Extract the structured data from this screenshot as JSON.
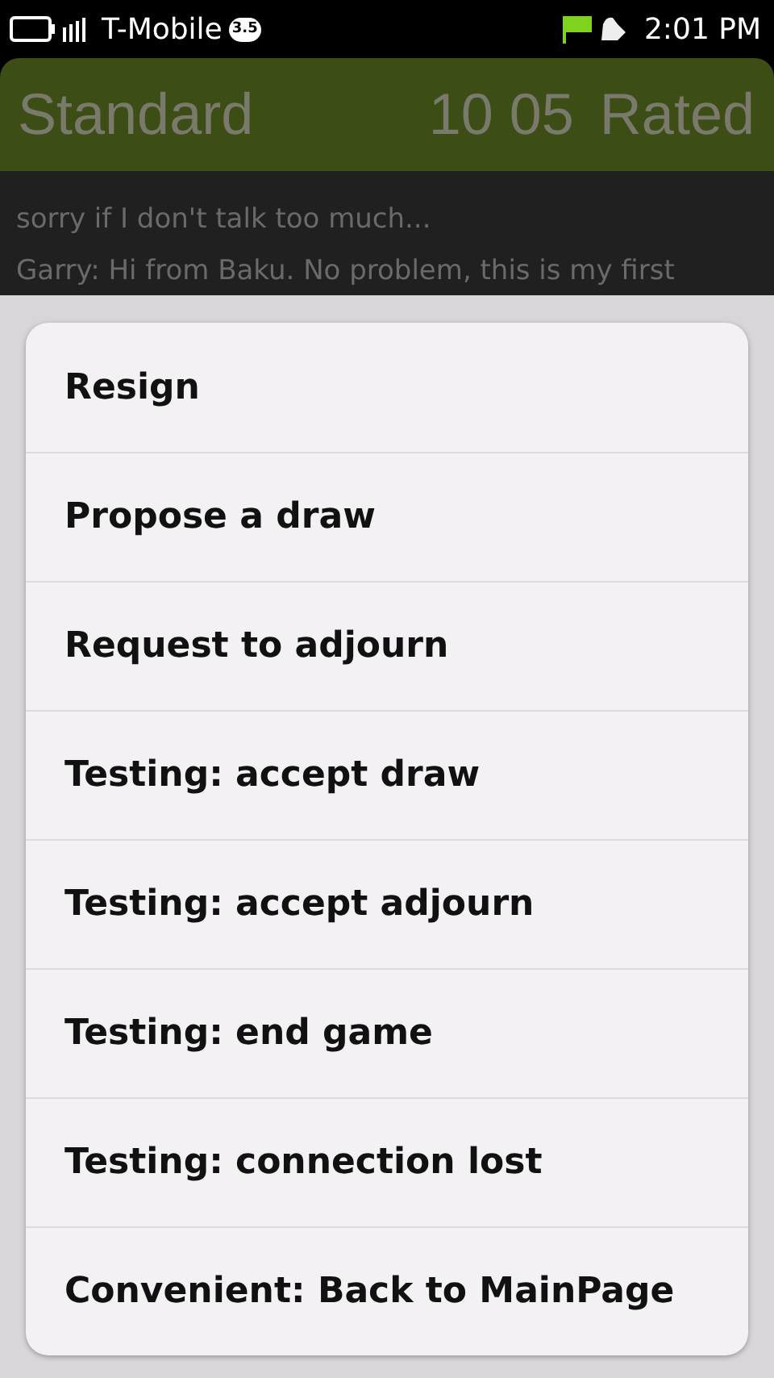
{
  "status_bar": {
    "carrier": "T-Mobile",
    "network_badge": "3.5",
    "time": "2:01 PM"
  },
  "header": {
    "title": "Standard",
    "time_control": "10 05",
    "rating": "Rated"
  },
  "chat": {
    "messages": [
      "sorry if I don't talk too much...",
      "Garry: Hi from Baku. No problem, this is my first"
    ]
  },
  "menu": {
    "items": [
      {
        "label": "Resign"
      },
      {
        "label": "Propose a draw"
      },
      {
        "label": "Request to adjourn"
      },
      {
        "label": "Testing: accept draw"
      },
      {
        "label": "Testing: accept adjourn"
      },
      {
        "label": "Testing: end game"
      },
      {
        "label": "Testing: connection lost"
      },
      {
        "label": "Convenient: Back to MainPage"
      }
    ]
  }
}
